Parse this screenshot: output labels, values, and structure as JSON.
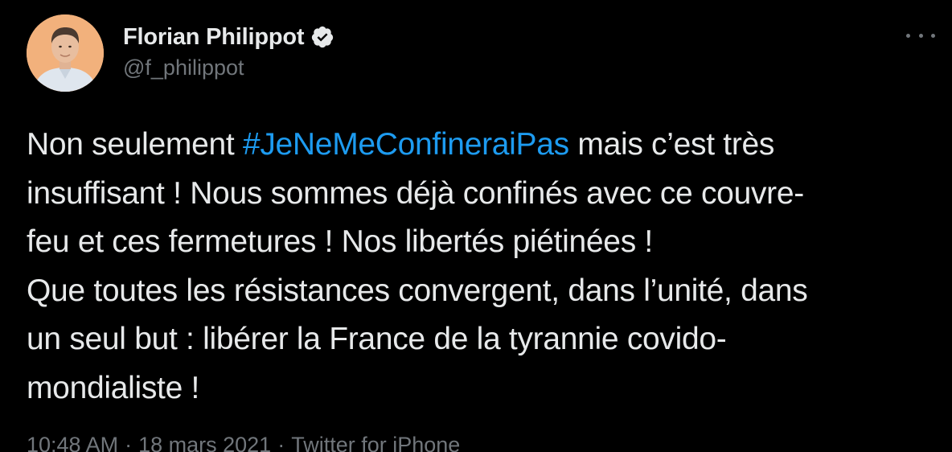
{
  "author": {
    "name": "Florian Philippot",
    "handle": "@f_philippot",
    "verified_icon": "verified-badge-icon",
    "avatar_bg": "#f2b17c"
  },
  "more_icon": "more-options-icon",
  "tweet": {
    "lines": [
      {
        "before": "Non seulement ",
        "hashtag": "#JeNeMeConfineraiPas",
        "after": " mais c’est très"
      },
      {
        "text": "insuffisant ! Nous sommes déjà confinés avec ce couvre-"
      },
      {
        "text": "feu et ces fermetures ! Nos libertés piétinées !"
      },
      {
        "text": "Que toutes les résistances convergent, dans l’unité, dans"
      },
      {
        "text": "un seul but : libérer la France de la tyrannie covido-"
      },
      {
        "text": "mondialiste !"
      }
    ]
  },
  "meta": {
    "time": "10:48 AM",
    "separator": "·",
    "date": "18 mars 2021",
    "source": "Twitter for iPhone"
  },
  "colors": {
    "background": "#000000",
    "text": "#e7e9ea",
    "secondary": "#71767b",
    "link": "#1d9bf0"
  }
}
